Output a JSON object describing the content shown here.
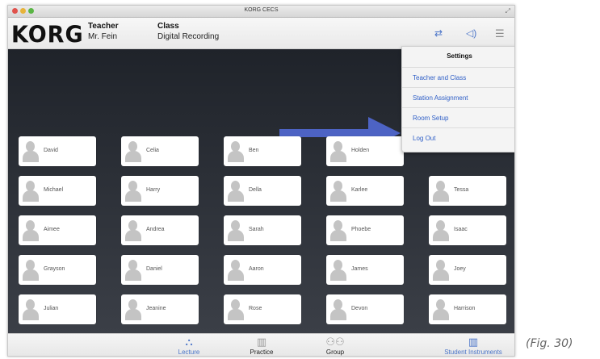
{
  "window": {
    "title": "KORG CECS"
  },
  "header": {
    "logo": "KORG",
    "teacher_label": "Teacher",
    "teacher_name": "Mr. Fein",
    "class_label": "Class",
    "class_name": "Digital Recording",
    "icons": [
      "shuffle-icon",
      "speaker-icon",
      "menu-icon"
    ],
    "accent_color": "#4a74c8"
  },
  "menu": {
    "title": "Settings",
    "items": [
      "Teacher and Class",
      "Station Assignment",
      "Room Setup",
      "Log Out"
    ]
  },
  "annotation": {
    "arrow_color": "#4d63c4"
  },
  "students": [
    [
      "David",
      "Celia",
      "Ben",
      "Holden"
    ],
    [
      "Michael",
      "Harry",
      "Della",
      "Karlee",
      "Tessa"
    ],
    [
      "Aimee",
      "Andrea",
      "Sarah",
      "Phoebe",
      "Isaac"
    ],
    [
      "Grayson",
      "Daniel",
      "Aaron",
      "James",
      "Joey"
    ],
    [
      "Julian",
      "Jeanine",
      "Rose",
      "Devon",
      "Harrison"
    ]
  ],
  "bottom_nav": {
    "items": [
      {
        "label": "Lecture",
        "icon": "lecture-icon",
        "glyph": "⛬",
        "active": true
      },
      {
        "label": "Practice",
        "icon": "practice-icon",
        "glyph": "▥",
        "active": false
      },
      {
        "label": "Group",
        "icon": "group-icon",
        "glyph": "⚇⚇",
        "active": false
      },
      {
        "label": "Student Instruments",
        "icon": "piano-icon",
        "glyph": "▥",
        "active": true
      }
    ]
  },
  "caption": "(Fig. 30)"
}
